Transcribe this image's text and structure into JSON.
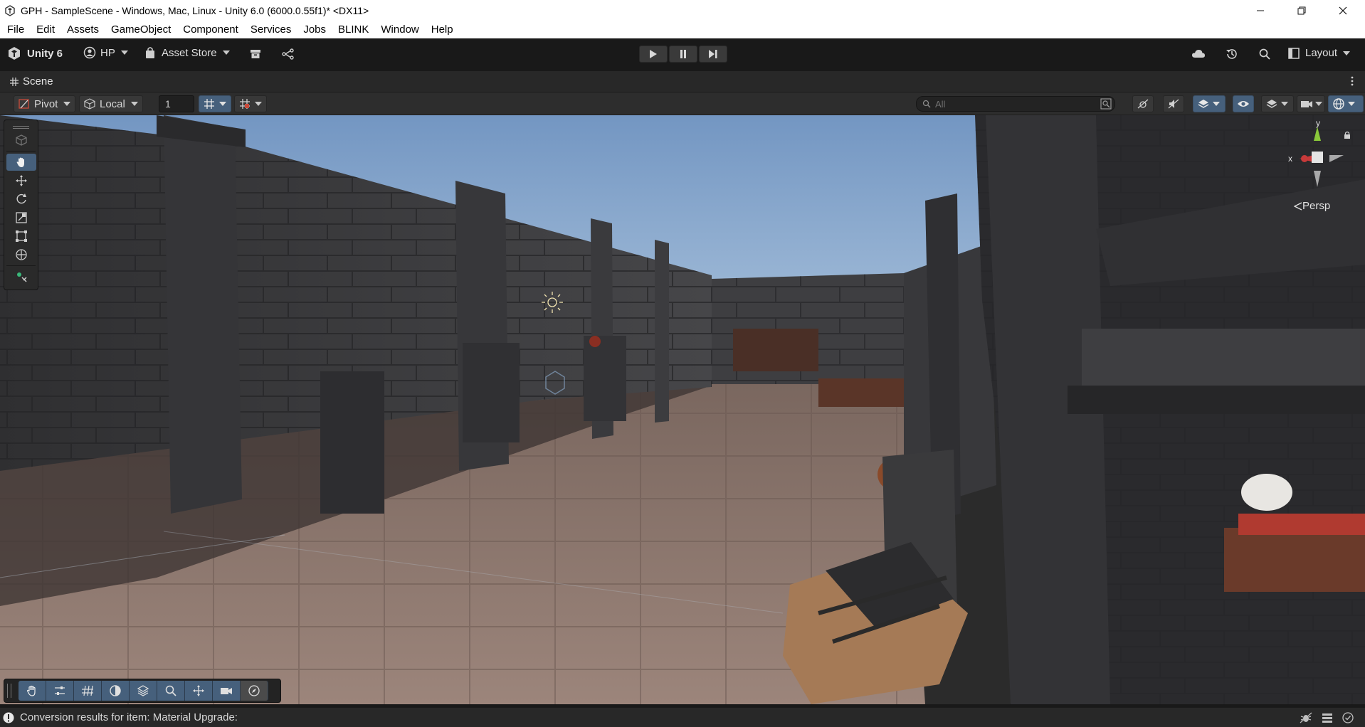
{
  "window": {
    "title": "GPH - SampleScene - Windows, Mac, Linux - Unity 6.0 (6000.0.55f1)* <DX11>"
  },
  "menu": [
    "File",
    "Edit",
    "Assets",
    "GameObject",
    "Component",
    "Services",
    "Jobs",
    "BLINK",
    "Window",
    "Help"
  ],
  "toolbar": {
    "unity_label": "Unity 6",
    "account_label": "HP",
    "asset_store_label": "Asset Store",
    "layout_label": "Layout"
  },
  "scene_tab": {
    "label": "Scene"
  },
  "scene_toolbar": {
    "pivot_label": "Pivot",
    "local_label": "Local",
    "grid_snap_value": "1",
    "search_placeholder": "All"
  },
  "viewport": {
    "camera_mode": "Persp",
    "gizmo_y": "y",
    "gizmo_x": "x"
  },
  "status": {
    "message": "Conversion results for item: Material Upgrade:"
  },
  "colors": {
    "accent": "#46607c",
    "sky": "#8fb0d6",
    "wall": "#3a3a3c",
    "floor": "#8a7268"
  }
}
